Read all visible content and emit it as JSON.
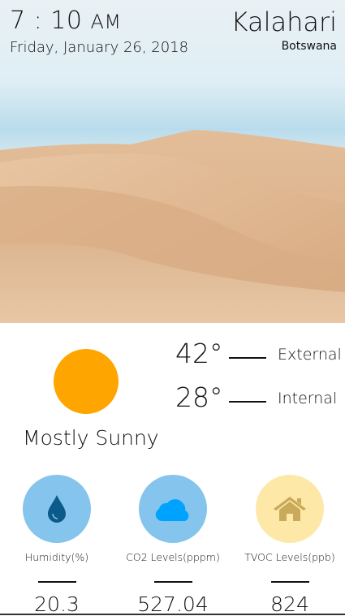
{
  "header": {
    "time": "7 : 10",
    "meridiem": "AM",
    "date": "Friday, January 26, 2018",
    "city": "Kalahari",
    "country": "Botswana"
  },
  "weather": {
    "condition": "Mostly Sunny",
    "sun_color": "#FFA500",
    "external": {
      "value": "42°",
      "label": "External"
    },
    "internal": {
      "value": "28°",
      "label": "Internal"
    }
  },
  "metrics": [
    {
      "icon": "water-drop-icon",
      "label": "Humidity(%)",
      "value": "20.3",
      "bg": "#85C4EC"
    },
    {
      "icon": "cloud-icon",
      "label": "CO2 Levels(pppm)",
      "value": "527.04",
      "bg": "#85C4EC"
    },
    {
      "icon": "home-icon",
      "label": "TVOC Levels(ppb)",
      "value": "824",
      "bg": "#FEE8A8"
    }
  ]
}
